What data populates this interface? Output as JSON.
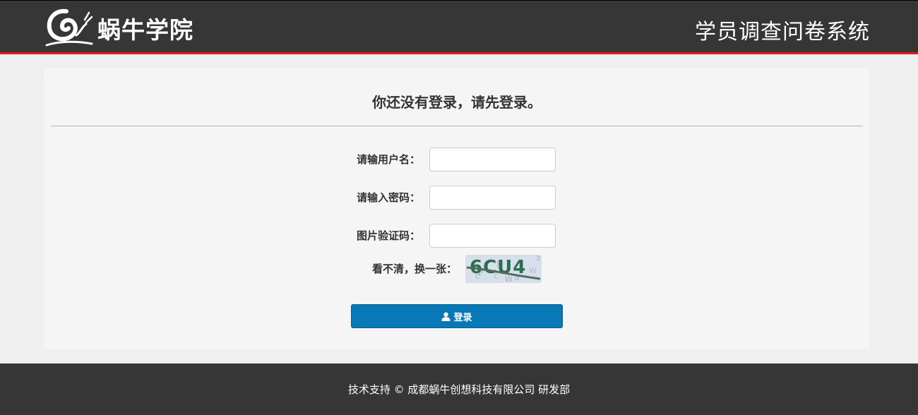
{
  "header": {
    "logo_text": "蜗牛学院",
    "system_title": "学员调查问卷系统"
  },
  "login": {
    "title": "你还没有登录，请先登录。",
    "username_label": "请输用户名：",
    "password_label": "请输入密码：",
    "captcha_label": "图片验证码：",
    "refresh_label": "看不清，换一张：",
    "captcha_text": "6CU4",
    "button_label": "登录",
    "button_icon": "user-icon"
  },
  "footer": {
    "text": "技术支持 © 成都蜗牛创想科技有限公司 研发部"
  },
  "colors": {
    "header_bg": "#363636",
    "header_border": "#e8191e",
    "page_bg": "#efefef",
    "panel_bg": "#f5f5f5",
    "button_bg": "#0879b6"
  }
}
